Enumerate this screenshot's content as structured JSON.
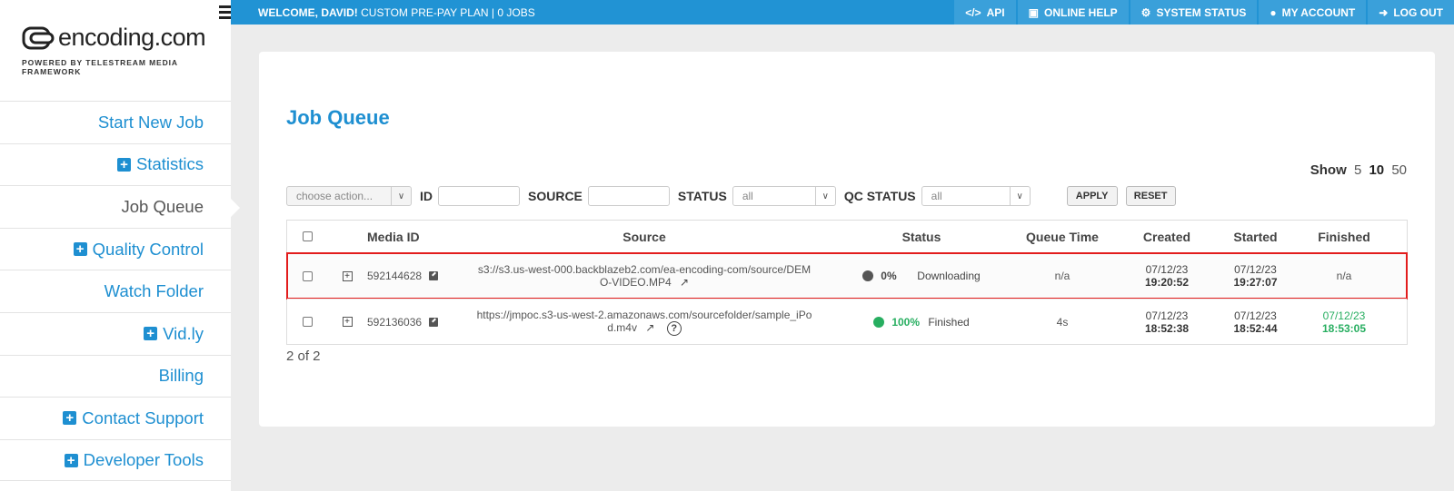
{
  "brand": {
    "name": "encoding.com",
    "tagline": "POWERED BY TELESTREAM MEDIA FRAMEWORK"
  },
  "topbar": {
    "welcome_bold": "WELCOME, DAVID!",
    "welcome_rest": " CUSTOM PRE-PAY PLAN | 0 JOBS",
    "links": [
      {
        "label": "API",
        "icon": "code-icon"
      },
      {
        "label": "ONLINE HELP",
        "icon": "monitor-icon"
      },
      {
        "label": "SYSTEM STATUS",
        "icon": "gears-icon"
      },
      {
        "label": "MY ACCOUNT",
        "icon": "user-icon"
      },
      {
        "label": "LOG OUT",
        "icon": "logout-icon"
      }
    ]
  },
  "sidebar": {
    "items": [
      {
        "label": "Start New Job",
        "plus": false,
        "active": false
      },
      {
        "label": "Statistics",
        "plus": true,
        "active": false
      },
      {
        "label": "Job Queue",
        "plus": false,
        "active": true
      },
      {
        "label": "Quality Control",
        "plus": true,
        "active": false
      },
      {
        "label": "Watch Folder",
        "plus": false,
        "active": false
      },
      {
        "label": "Vid.ly",
        "plus": true,
        "active": false
      },
      {
        "label": "Billing",
        "plus": false,
        "active": false
      },
      {
        "label": "Contact Support",
        "plus": true,
        "active": false
      },
      {
        "label": "Developer Tools",
        "plus": true,
        "active": false
      }
    ]
  },
  "main": {
    "title": "Job Queue",
    "show_label": "Show",
    "show_options": [
      "5",
      "10",
      "50"
    ],
    "show_selected": "10",
    "filters": {
      "action_placeholder": "choose action...",
      "id_label": "ID",
      "source_label": "SOURCE",
      "status_label": "STATUS",
      "status_value": "all",
      "qc_label": "QC STATUS",
      "qc_value": "all",
      "apply": "APPLY",
      "reset": "RESET"
    },
    "columns": [
      "Media ID",
      "Source",
      "Status",
      "Queue Time",
      "Created",
      "Started",
      "Finished"
    ],
    "rows": [
      {
        "media_id": "592144628",
        "source": "s3://s3.us-west-000.backblazeb2.com/ea-encoding-com/source/DEMO-VIDEO.MP4",
        "percent": "0%",
        "status": "Downloading",
        "status_color": "#555555",
        "queue_time": "n/a",
        "created_date": "07/12/23",
        "created_time": "19:20:52",
        "started_date": "07/12/23",
        "started_time": "19:27:07",
        "finished": "n/a",
        "highlighted": true
      },
      {
        "media_id": "592136036",
        "source": "https://jmpoc.s3-us-west-2.amazonaws.com/sourcefolder/sample_iPod.m4v",
        "percent": "100%",
        "status": "Finished",
        "status_color": "#27ae60",
        "queue_time": "4s",
        "created_date": "07/12/23",
        "created_time": "18:52:38",
        "started_date": "07/12/23",
        "started_time": "18:52:44",
        "finished_date": "07/12/23",
        "finished_time": "18:53:05",
        "highlighted": false
      }
    ],
    "count": "2 of 2"
  }
}
